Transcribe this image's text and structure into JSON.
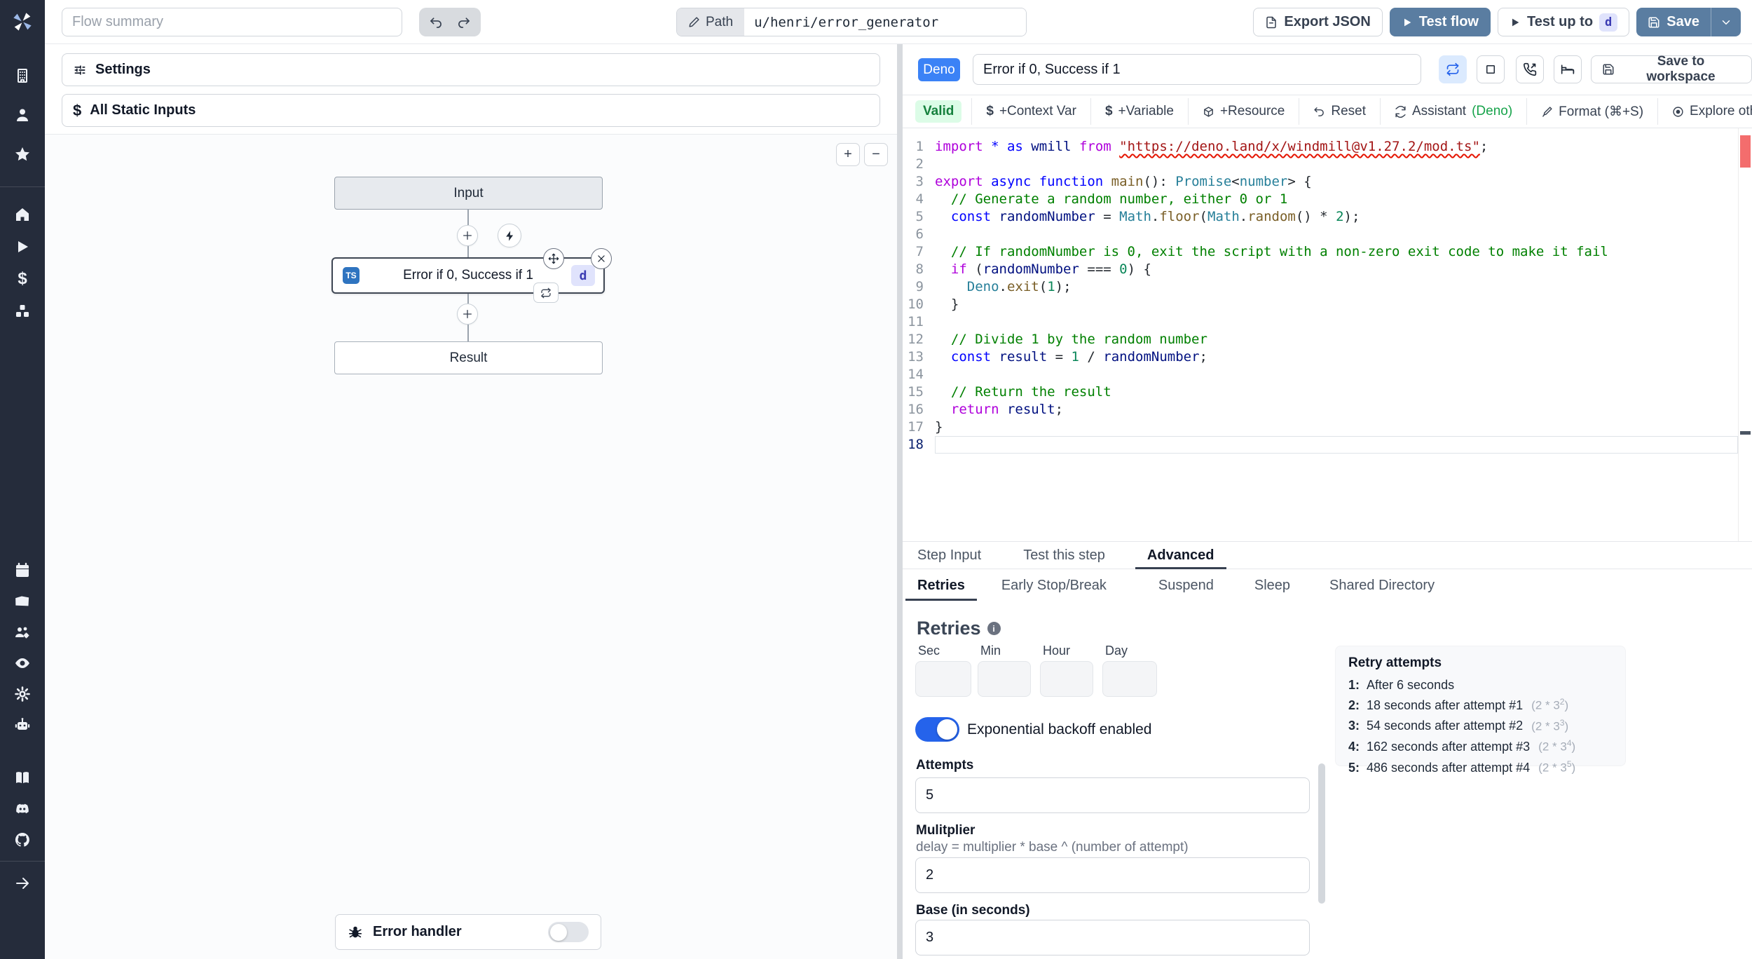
{
  "topbar": {
    "flow_summary_placeholder": "Flow summary",
    "path_label": "Path",
    "path_value": "u/henri/error_generator",
    "export_json_label": "Export JSON",
    "test_flow_label": "Test flow",
    "test_up_to_label": "Test up to",
    "test_up_to_step": "d",
    "save_label": "Save"
  },
  "sidebar": {
    "icons": [
      "windmill-logo",
      "building",
      "user",
      "star",
      "home",
      "play",
      "dollar",
      "cubes",
      "calendar",
      "folder",
      "user-group",
      "eye",
      "gear",
      "robot",
      "book",
      "discord",
      "github",
      "arrow-right"
    ]
  },
  "flow": {
    "settings_label": "Settings",
    "all_static_inputs_label": "All Static Inputs",
    "input_node_label": "Input",
    "step_node": {
      "lang_badge": "TS",
      "title": "Error if 0, Success if 1",
      "id_badge": "d"
    },
    "result_node_label": "Result",
    "error_handler_label": "Error handler"
  },
  "editor": {
    "lang_badge": "Deno",
    "step_title": "Error if 0, Success if 1",
    "save_to_workspace_label": "Save to workspace",
    "toolbar": {
      "valid_label": "Valid",
      "context_var_label": "+Context Var",
      "variable_label": "+Variable",
      "resource_label": "+Resource",
      "reset_label": "Reset",
      "assistant_label": "Assistant ",
      "assistant_lang": "(Deno)",
      "format_label": "Format (⌘+S)",
      "explore_label": "Explore other s"
    },
    "code_lines": [
      {
        "n": "1",
        "tokens": [
          [
            "p",
            "import"
          ],
          [
            "d",
            " "
          ],
          [
            "b",
            "* as"
          ],
          [
            "v",
            " wmill"
          ],
          [
            "p",
            " from"
          ],
          [
            "d",
            " "
          ],
          [
            "sq",
            "\"https://deno.land/x/windmill@v1.27.2/mod.ts\""
          ],
          [
            "d",
            ";"
          ]
        ]
      },
      {
        "n": "2",
        "tokens": []
      },
      {
        "n": "3",
        "tokens": [
          [
            "p",
            "export"
          ],
          [
            "b",
            " async function"
          ],
          [
            "f",
            " main"
          ],
          [
            "d",
            "(): "
          ],
          [
            "t",
            "Promise"
          ],
          [
            "d",
            "<"
          ],
          [
            "t",
            "number"
          ],
          [
            "d",
            "> {"
          ]
        ]
      },
      {
        "n": "4",
        "tokens": [
          [
            "c",
            "  // Generate a random number, either 0 or 1"
          ]
        ]
      },
      {
        "n": "5",
        "tokens": [
          [
            "b",
            "  const"
          ],
          [
            "v",
            " randomNumber"
          ],
          [
            "d",
            " = "
          ],
          [
            "t",
            "Math"
          ],
          [
            "d",
            "."
          ],
          [
            "f",
            "floor"
          ],
          [
            "d",
            "("
          ],
          [
            "t",
            "Math"
          ],
          [
            "d",
            "."
          ],
          [
            "f",
            "random"
          ],
          [
            "d",
            "() * "
          ],
          [
            "n",
            "2"
          ],
          [
            "d",
            ");"
          ]
        ]
      },
      {
        "n": "6",
        "tokens": []
      },
      {
        "n": "7",
        "tokens": [
          [
            "c",
            "  // If randomNumber is 0, exit the script with a non-zero exit code to make it fail"
          ]
        ]
      },
      {
        "n": "8",
        "tokens": [
          [
            "p",
            "  if"
          ],
          [
            "d",
            " ("
          ],
          [
            "v",
            "randomNumber"
          ],
          [
            "d",
            " === "
          ],
          [
            "n",
            "0"
          ],
          [
            "d",
            ") {"
          ]
        ]
      },
      {
        "n": "9",
        "tokens": [
          [
            "t",
            "    Deno"
          ],
          [
            "d",
            "."
          ],
          [
            "f",
            "exit"
          ],
          [
            "d",
            "("
          ],
          [
            "n",
            "1"
          ],
          [
            "d",
            ");"
          ]
        ]
      },
      {
        "n": "10",
        "tokens": [
          [
            "d",
            "  }"
          ]
        ]
      },
      {
        "n": "11",
        "tokens": []
      },
      {
        "n": "12",
        "tokens": [
          [
            "c",
            "  // Divide 1 by the random number"
          ]
        ]
      },
      {
        "n": "13",
        "tokens": [
          [
            "b",
            "  const"
          ],
          [
            "v",
            " result"
          ],
          [
            "d",
            " = "
          ],
          [
            "n",
            "1"
          ],
          [
            "d",
            " / "
          ],
          [
            "v",
            "randomNumber"
          ],
          [
            "d",
            ";"
          ]
        ]
      },
      {
        "n": "14",
        "tokens": []
      },
      {
        "n": "15",
        "tokens": [
          [
            "c",
            "  // Return the result"
          ]
        ]
      },
      {
        "n": "16",
        "tokens": [
          [
            "p",
            "  return"
          ],
          [
            "v",
            " result"
          ],
          [
            "d",
            ";"
          ]
        ]
      },
      {
        "n": "17",
        "tokens": [
          [
            "d",
            "}"
          ]
        ]
      },
      {
        "n": "18",
        "tokens": [],
        "current": true
      }
    ]
  },
  "advanced": {
    "tabs": {
      "step_input": "Step Input",
      "test_step": "Test this step",
      "advanced": "Advanced"
    },
    "subtabs": {
      "retries": "Retries",
      "early_stop": "Early Stop/Break",
      "suspend": "Suspend",
      "sleep": "Sleep",
      "shared_dir": "Shared Directory"
    },
    "retries": {
      "heading": "Retries",
      "time_labels": {
        "sec": "Sec",
        "min": "Min",
        "hour": "Hour",
        "day": "Day"
      },
      "backoff_label": "Exponential backoff enabled",
      "attempts_label": "Attempts",
      "attempts_value": "5",
      "multiplier_label": "Mulitplier",
      "multiplier_help": "delay = multiplier * base ^ (number of attempt)",
      "multiplier_value": "2",
      "base_label": "Base (in seconds)",
      "base_value": "3"
    },
    "retry_panel": {
      "title": "Retry attempts",
      "items": [
        {
          "num": "1:",
          "text": "After 6 seconds"
        },
        {
          "num": "2:",
          "text": "18 seconds after attempt #1",
          "formula": "(2 * 3",
          "exp": "2"
        },
        {
          "num": "3:",
          "text": "54 seconds after attempt #2",
          "formula": "(2 * 3",
          "exp": "3"
        },
        {
          "num": "4:",
          "text": "162 seconds after attempt #3",
          "formula": "(2 * 3",
          "exp": "4"
        },
        {
          "num": "5:",
          "text": "486 seconds after attempt #4",
          "formula": "(2 * 3",
          "exp": "5"
        }
      ]
    }
  },
  "colors": {
    "primary_button": "#5a7da1",
    "deno_badge": "#3b82f6",
    "toggle_on": "#2563eb",
    "valid_bg": "#dcfce7",
    "valid_text": "#15803d"
  }
}
